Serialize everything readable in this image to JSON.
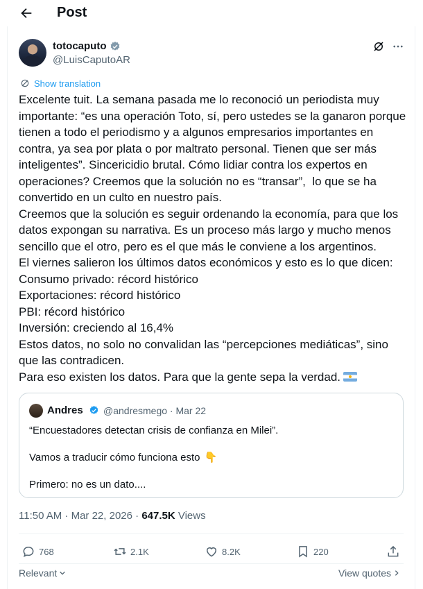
{
  "header": {
    "title": "Post"
  },
  "author": {
    "name": "totocaputo",
    "handle": "@LuisCaputoAR"
  },
  "translate_label": "Show translation",
  "tweet": {
    "paragraphs": [
      "Excelente tuit. La semana pasada me lo reconoció un periodista muy importante: “es una operación Toto, sí, pero ustedes se la ganaron porque tienen a todo el periodismo y a algunos empresarios importantes en contra, ya sea por plata o por maltrato personal. Tienen que ser más inteligentes”. Sincericidio brutal. Cómo lidiar contra los expertos en operaciones? Creemos que la solución no es “transar”,  lo que se ha convertido en un culto en nuestro país.",
      "Creemos que la solución es seguir ordenando la economía, para que los datos expongan su narrativa. Es un proceso más largo y mucho menos sencillo que el otro, pero es el que más le conviene a los argentinos.",
      "El viernes salieron los últimos datos económicos y esto es lo que dicen:",
      "Consumo privado: récord histórico",
      "Exportaciones: récord histórico",
      "PBI: récord histórico",
      "Inversión: creciendo al 16,4%",
      "Estos datos, no solo no convalidan las “percepciones mediáticas”, sino que las contradicen.",
      "Para eso existen los datos. Para que la gente sepa la verdad."
    ]
  },
  "quote": {
    "name": "Andres",
    "handle_date": "@andresmego · Mar 22",
    "line1": "“Encuestadores detectan crisis de confianza en Milei”.",
    "line2": "Vamos a traducir cómo funciona esto",
    "line3": "Primero: no es un dato...."
  },
  "meta": {
    "time_date": "11:50 AM · Mar 22, 2026 · ",
    "views_count": "647.5K",
    "views_label": " Views"
  },
  "actions": {
    "replies": "768",
    "reposts": "2.1K",
    "likes": "8.2K",
    "bookmarks": "220"
  },
  "footer": {
    "sort_label": "Relevant",
    "view_quotes_label": "View quotes"
  },
  "colors": {
    "accent": "#1d9bf0",
    "secondary_text": "#536471",
    "border": "#cfd9de"
  },
  "icons": [
    "back-arrow-icon",
    "verified-icon",
    "grok-icon",
    "more-icon",
    "translate-icon",
    "reply-icon",
    "repost-icon",
    "like-icon",
    "bookmark-icon",
    "share-icon",
    "argentina-flag-icon",
    "pointing-down-icon"
  ]
}
